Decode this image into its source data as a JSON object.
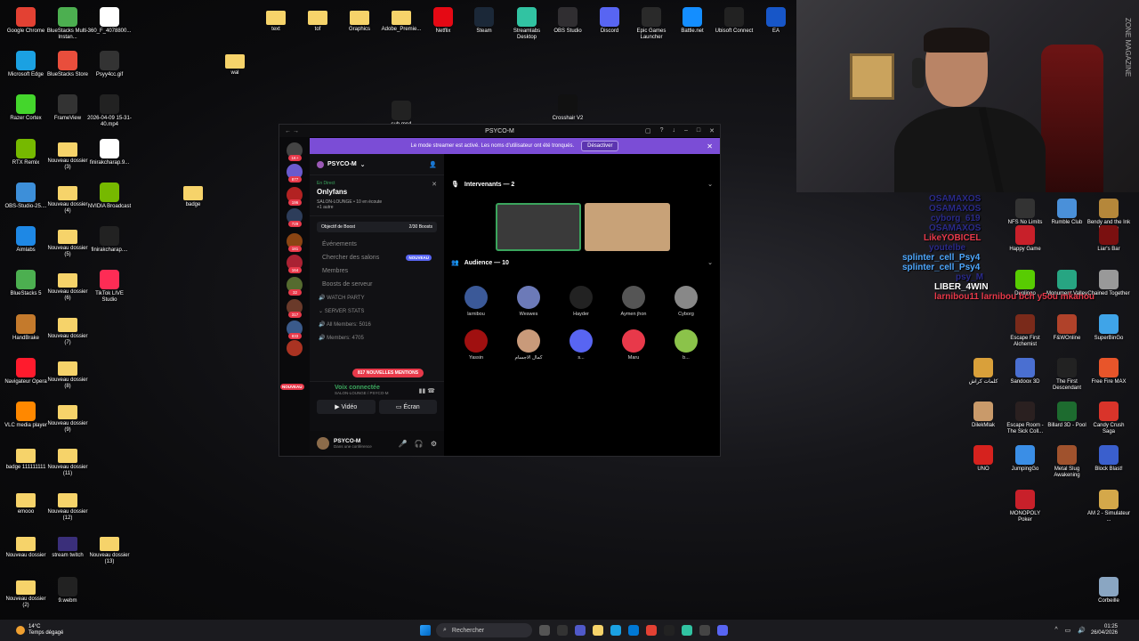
{
  "desktop": {
    "icons": [
      {
        "label": "Google Chrome",
        "icon": "chrome-icon",
        "color": "#e34133"
      },
      {
        "label": "BlueStacks Multi-Instan...",
        "icon": "bluestacks-icon",
        "color": "#4caf50"
      },
      {
        "label": "360_F_4078800...",
        "icon": "image-file-icon",
        "color": "#ffffff"
      },
      {
        "label": "text",
        "icon": "folder-icon",
        "color": "#f6d36a"
      },
      {
        "label": "tof",
        "icon": "folder-icon",
        "color": "#f6d36a"
      },
      {
        "label": "Graphics",
        "icon": "folder-icon",
        "color": "#f6d36a"
      },
      {
        "label": "Adobe_Premie...",
        "icon": "folder-icon",
        "color": "#f6d36a"
      },
      {
        "label": "Netflix",
        "icon": "netflix-icon",
        "color": "#e50914"
      },
      {
        "label": "Steam",
        "icon": "steam-icon",
        "color": "#1b2838"
      },
      {
        "label": "Streamlabs Desktop",
        "icon": "streamlabs-icon",
        "color": "#31c3a2"
      },
      {
        "label": "OBS Studio",
        "icon": "obs-icon",
        "color": "#302e31"
      },
      {
        "label": "Discord",
        "icon": "discord-icon",
        "color": "#5865f2"
      },
      {
        "label": "Epic Games Launcher",
        "icon": "epic-icon",
        "color": "#2a2a2a"
      },
      {
        "label": "Battle.net",
        "icon": "battlenet-icon",
        "color": "#148eff"
      },
      {
        "label": "Ubisoft Connect",
        "icon": "ubisoft-icon",
        "color": "#222222"
      },
      {
        "label": "EA",
        "icon": "ea-icon",
        "color": "#1756c8"
      },
      {
        "label": "Microsoft Edge",
        "icon": "edge-icon",
        "color": "#1ba1e2"
      },
      {
        "label": "BlueStacks Store",
        "icon": "bluestacks-store-icon",
        "color": "#e94e3c"
      },
      {
        "label": "Psyy4cc.gif",
        "icon": "gif-file-icon",
        "color": "#333333"
      },
      {
        "label": "wal",
        "icon": "folder-icon",
        "color": "#f6d36a"
      },
      {
        "label": "Razer Cortex",
        "icon": "razer-icon",
        "color": "#44d62c"
      },
      {
        "label": "FrameView",
        "icon": "frameview-icon",
        "color": "#333333"
      },
      {
        "label": "2026-04-09 15-31-40.mp4",
        "icon": "video-file-icon",
        "color": "#222222"
      },
      {
        "label": "sub.mp4",
        "icon": "video-file-icon",
        "color": "#222222"
      },
      {
        "label": "Crosshair V2",
        "icon": "crosshair-icon",
        "color": "#111111"
      },
      {
        "label": "RTX Remix",
        "icon": "rtx-icon",
        "color": "#76b900"
      },
      {
        "label": "Nouveau dossier (3)",
        "icon": "folder-icon",
        "color": "#f6d36a"
      },
      {
        "label": "finirakcharap.9...",
        "icon": "file-icon",
        "color": "#ffffff"
      },
      {
        "label": "OBS-Studio-25....",
        "icon": "obs-installer-icon",
        "color": "#3d8fd9"
      },
      {
        "label": "Nouveau dossier (4)",
        "icon": "folder-icon",
        "color": "#f6d36a"
      },
      {
        "label": "NVIDIA Broadcast",
        "icon": "nvidia-icon",
        "color": "#76b900"
      },
      {
        "label": "badge",
        "icon": "folder-icon",
        "color": "#f6d36a"
      },
      {
        "label": "Aimlabs",
        "icon": "aimlabs-icon",
        "color": "#1e88e5"
      },
      {
        "label": "Nouveau dossier (5)",
        "icon": "folder-icon",
        "color": "#f6d36a"
      },
      {
        "label": "finirakcharap....",
        "icon": "video-file-icon",
        "color": "#222222"
      },
      {
        "label": "BlueStacks 5",
        "icon": "bluestacks5-icon",
        "color": "#4caf50"
      },
      {
        "label": "Nouveau dossier (6)",
        "icon": "folder-icon",
        "color": "#f6d36a"
      },
      {
        "label": "TikTok LIVE Studio",
        "icon": "tiktok-icon",
        "color": "#fe2c55"
      },
      {
        "label": "HandBrake",
        "icon": "handbrake-icon",
        "color": "#c47a2c"
      },
      {
        "label": "Nouveau dossier (7)",
        "icon": "folder-icon",
        "color": "#f6d36a"
      },
      {
        "label": "Navigateur Opera",
        "icon": "opera-icon",
        "color": "#ff1b2d"
      },
      {
        "label": "Nouveau dossier (8)",
        "icon": "folder-icon",
        "color": "#f6d36a"
      },
      {
        "label": "VLC media player",
        "icon": "vlc-icon",
        "color": "#ff8800"
      },
      {
        "label": "Nouveau dossier (9)",
        "icon": "folder-icon",
        "color": "#f6d36a"
      },
      {
        "label": "badge 111111111",
        "icon": "folder-icon",
        "color": "#f6d36a"
      },
      {
        "label": "Nouveau dossier (11)",
        "icon": "folder-icon",
        "color": "#f6d36a"
      },
      {
        "label": "emooo",
        "icon": "folder-icon",
        "color": "#f6d36a"
      },
      {
        "label": "Nouveau dossier (12)",
        "icon": "folder-icon",
        "color": "#f6d36a"
      },
      {
        "label": "Nouveau dossier",
        "icon": "folder-icon",
        "color": "#f6d36a"
      },
      {
        "label": "stream twitch",
        "icon": "folder-icon",
        "color": "#3a2f7a"
      },
      {
        "label": "Nouveau dossier (13)",
        "icon": "folder-icon",
        "color": "#f6d36a"
      },
      {
        "label": "Nouveau dossier (2)",
        "icon": "folder-icon",
        "color": "#f6d36a"
      },
      {
        "label": "9.webm",
        "icon": "video-file-icon",
        "color": "#222222"
      }
    ],
    "right_icons": [
      {
        "label": "NFS No Limits",
        "color": "#333333"
      },
      {
        "label": "Rumble Club",
        "color": "#4a90d9"
      },
      {
        "label": "Bendy and the Ink Machine",
        "color": "#b5873a"
      },
      {
        "label": "Happy Game",
        "color": "#c8202a"
      },
      {
        "label": "Liar's Bar",
        "color": "#7a1010"
      },
      {
        "label": "Duolingo",
        "color": "#58cc02"
      },
      {
        "label": "Monument Valley",
        "color": "#27a582"
      },
      {
        "label": "Chained Together",
        "color": "#999999"
      },
      {
        "label": "Escape First Alchemist",
        "color": "#7a2a1a"
      },
      {
        "label": "F&WOnline",
        "color": "#b0422a"
      },
      {
        "label": "SuperBinGo",
        "color": "#3fa4e8"
      },
      {
        "label": "كلمات كراش",
        "color": "#d9a03a"
      },
      {
        "label": "Sandoox 3D",
        "color": "#4a6fd1"
      },
      {
        "label": "The First Descendant",
        "color": "#222222"
      },
      {
        "label": "Free Fire MAX",
        "color": "#e8552a"
      },
      {
        "label": "DilekMlak",
        "color": "#c99a6a"
      },
      {
        "label": "Escape Room - The Sick Coll...",
        "color": "#2a2020"
      },
      {
        "label": "Billard 3D - Pool",
        "color": "#1d6b2f"
      },
      {
        "label": "Candy Crush Saga",
        "color": "#d9342a"
      },
      {
        "label": "UNO",
        "color": "#d6221e"
      },
      {
        "label": "JumpingGo",
        "color": "#3a8ee6"
      },
      {
        "label": "Metal Slug Awakening",
        "color": "#a0522d"
      },
      {
        "label": "Block Blast!",
        "color": "#3a5fcd"
      },
      {
        "label": "MONOPOLY Poker",
        "color": "#c8202a"
      },
      {
        "label": "AM 2 - Simulateur ...",
        "color": "#d4a84a"
      },
      {
        "label": "Corbeille",
        "color": "#8aa6c2"
      }
    ]
  },
  "webcam": {
    "brand_text": "ZONE MAGAZINE"
  },
  "chat": {
    "lines": [
      {
        "text": "OSAMAXOS",
        "color": "#2a2a8a"
      },
      {
        "text": "OSAMAXOS",
        "color": "#2a2a8a"
      },
      {
        "text": "cyborg_619",
        "color": "#2a2a8a"
      },
      {
        "text": "OSAMAXOS",
        "color": "#2a2a8a"
      },
      {
        "text": "LikeYOBICEL",
        "color": "#e8394a"
      },
      {
        "text": "youtelbe",
        "color": "#2a2a8a"
      },
      {
        "text": "splinter_cell_Psy4",
        "color": "#4ea8ff"
      },
      {
        "text": "splinter_cell_Psy4",
        "color": "#4ea8ff"
      },
      {
        "text": "psy_M",
        "color": "#2a2a8a"
      },
      {
        "text": "LIBER_4WIN",
        "color": "#ffffff"
      },
      {
        "text": "larnibou11  larnibou bch y5ou mkanou",
        "color": "#e8394a"
      }
    ]
  },
  "discord": {
    "window_title": "PSYCO-M",
    "streamer_banner": "Le mode streamer est activé. Les noms d'utilisateur ont été tronqués.",
    "streamer_button": "Désactiver",
    "server_name": "PSYCO-M",
    "live_tag": "En Direct",
    "live_channel": "Onlyfans",
    "live_meta": "SALON-LOUNGE  •  10 en écoute",
    "live_meta2": "+1 autre",
    "boost_label": "Objectif de Boost",
    "boost_count": "2/30 Boosts",
    "menu": [
      {
        "label": "Événements",
        "tag": ""
      },
      {
        "label": "Chercher des salons",
        "tag": "NOUVEAU"
      },
      {
        "label": "Membres",
        "tag": ""
      },
      {
        "label": "Boosts de serveur",
        "tag": ""
      }
    ],
    "watch_party": "WATCH PARTY",
    "server_stats": "SERVER STATS",
    "all_members": "All Members: 5016",
    "members_partial": "Members: 4705",
    "new_mentions": "817 NOUVELLES MENTIONS",
    "rail_new": "NOUVEAU",
    "rail_badges": [
      "1K+",
      "877",
      "196",
      "729",
      "181",
      "164",
      "32",
      "317",
      "833"
    ],
    "voice_status": "Voix connectée",
    "voice_channel": "SALON-LOUNGE / PSYCO-M",
    "video_label": "Vidéo",
    "screen_label": "Écran",
    "user_name": "PSYCO-M",
    "user_status": "Dans une conférence",
    "speakers_label": "Intervenants — 2",
    "audience_label": "Audience — 10",
    "audience": [
      {
        "name": "larnibou",
        "color": "#3b5998"
      },
      {
        "name": "Weswes",
        "color": "#6c7ab8"
      },
      {
        "name": "Hayder",
        "color": "#222222"
      },
      {
        "name": "Aymen jhon",
        "color": "#555555"
      },
      {
        "name": "Cyborg",
        "color": "#888888"
      },
      {
        "name": "Yassin",
        "color": "#a01010"
      },
      {
        "name": "كمال الاجسام",
        "color": "#c99a7a"
      },
      {
        "name": "s...",
        "color": "#5865f2"
      },
      {
        "name": "Maru",
        "color": "#e8394a"
      },
      {
        "name": "b...",
        "color": "#8bc34a"
      }
    ]
  },
  "taskbar": {
    "temp": "14°C",
    "weather": "Temps dégagé",
    "search_placeholder": "Rechercher",
    "time": "01:25",
    "date": "26/04/2026"
  }
}
